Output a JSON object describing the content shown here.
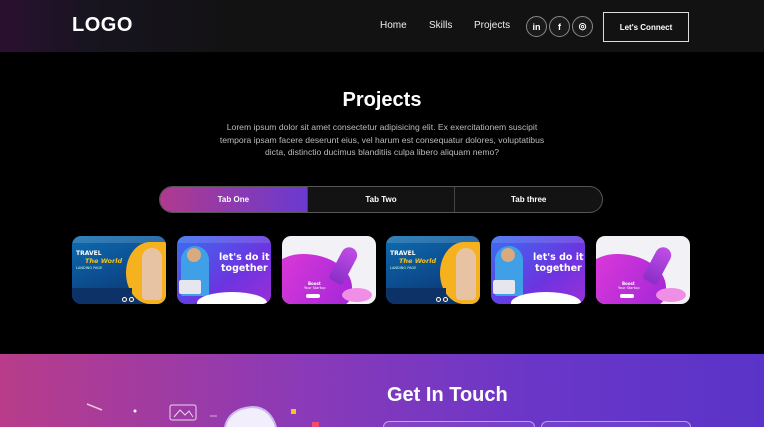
{
  "nav": {
    "logo": "LOGO",
    "links": [
      "Home",
      "Skills",
      "Projects"
    ],
    "social": [
      "in",
      "f",
      "◎"
    ],
    "cta": "Let's Connect"
  },
  "projects": {
    "title": "Projects",
    "description": "Lorem ipsum dolor sit amet consectetur adipisicing elit. Ex exercitationem suscipit tempora ipsam facere deserunt eius, vel harum est consequatur dolores, voluptatibus dicta, distinctio ducimus blanditiis culpa libero aliquam nemo?",
    "tabs": [
      "Tab One",
      "Tab Two",
      "Tab three"
    ],
    "cards": [
      {
        "kind": "travel",
        "line1": "TRAVEL",
        "line2": "The World",
        "line3": "LANDING PAGE"
      },
      {
        "kind": "together",
        "line1": "let's do it",
        "line2": "together"
      },
      {
        "kind": "startup",
        "line1": "Boost",
        "line2": "Your Startup"
      },
      {
        "kind": "travel",
        "line1": "TRAVEL",
        "line2": "The World",
        "line3": "LANDING PAGE"
      },
      {
        "kind": "together",
        "line1": "let's do it",
        "line2": "together"
      },
      {
        "kind": "startup",
        "line1": "Boost",
        "line2": "Your Startup"
      }
    ]
  },
  "contact": {
    "title": "Get In Touch"
  }
}
